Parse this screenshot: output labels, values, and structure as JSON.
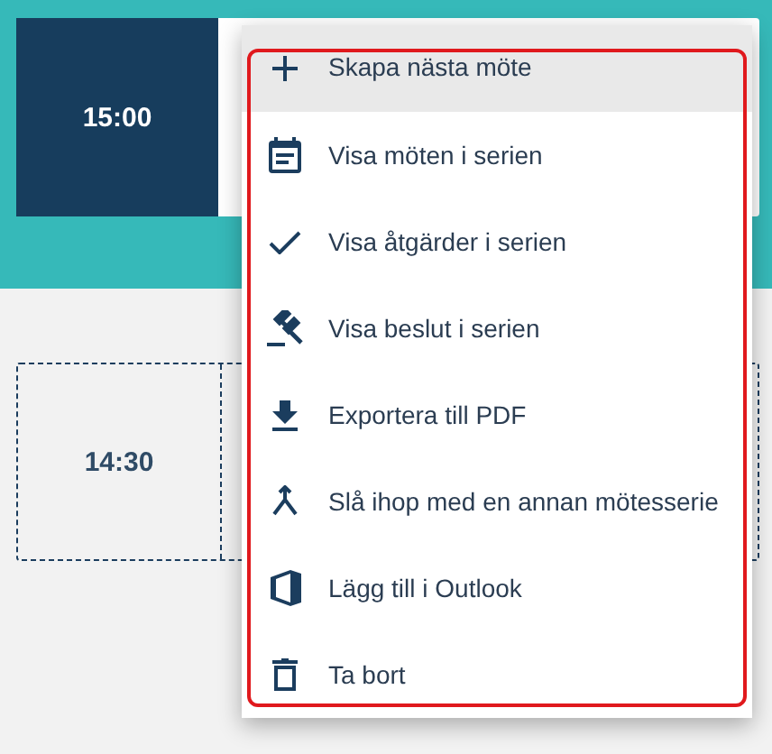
{
  "meetings": [
    {
      "time": "15:00",
      "kind": "current"
    },
    {
      "time": "14:30",
      "kind": "planned"
    }
  ],
  "menu": {
    "outlined": true,
    "items": [
      {
        "kind": "create",
        "label": "Skapa nästa möte",
        "highlighted": true
      },
      {
        "kind": "list",
        "label": "Visa möten i serien",
        "highlighted": false
      },
      {
        "kind": "check",
        "label": "Visa åtgärder i serien",
        "highlighted": false
      },
      {
        "kind": "gavel",
        "label": "Visa beslut i serien",
        "highlighted": false
      },
      {
        "kind": "export",
        "label": "Exportera till PDF",
        "highlighted": false
      },
      {
        "kind": "merge",
        "label": "Slå ihop med en annan mötesserie",
        "highlighted": false
      },
      {
        "kind": "office",
        "label": "Lägg till i Outlook",
        "highlighted": false
      },
      {
        "kind": "delete",
        "label": "Ta bort",
        "highlighted": false
      }
    ]
  }
}
